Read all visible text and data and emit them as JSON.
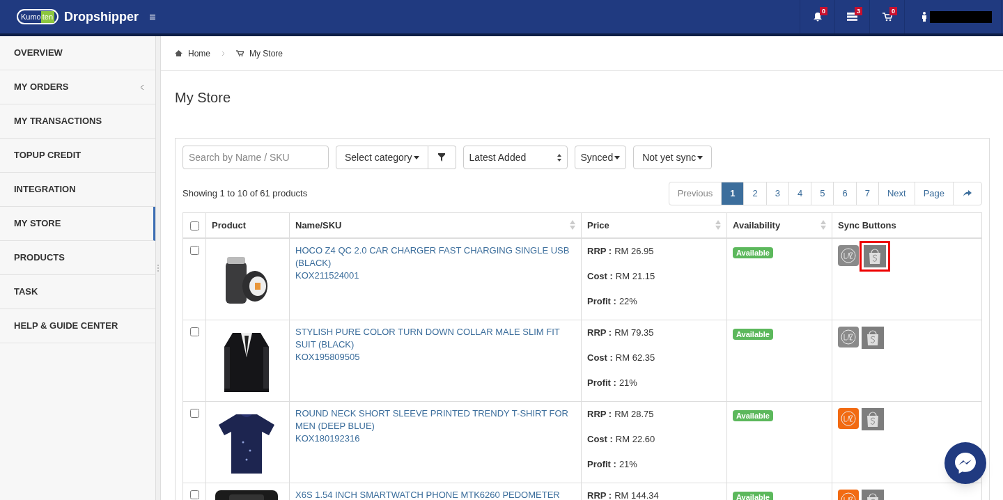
{
  "header": {
    "logo": {
      "word_a": "Kumo",
      "word_b": "ten"
    },
    "title": "Dropshipper",
    "badges": [
      {
        "kind": "bell",
        "count": "0"
      },
      {
        "kind": "messages",
        "count": "3"
      },
      {
        "kind": "cart",
        "count": "0"
      }
    ]
  },
  "sidebar": {
    "items": [
      {
        "label": "OVERVIEW",
        "selected": false,
        "expandable": false
      },
      {
        "label": "MY ORDERS",
        "selected": false,
        "expandable": true
      },
      {
        "label": "MY TRANSACTIONS",
        "selected": false,
        "expandable": false
      },
      {
        "label": "TOPUP CREDIT",
        "selected": false,
        "expandable": false
      },
      {
        "label": "INTEGRATION",
        "selected": false,
        "expandable": false
      },
      {
        "label": "MY STORE",
        "selected": true,
        "expandable": false
      },
      {
        "label": "PRODUCTS",
        "selected": false,
        "expandable": false
      },
      {
        "label": "TASK",
        "selected": false,
        "expandable": false
      },
      {
        "label": "HELP & GUIDE CENTER",
        "selected": false,
        "expandable": false
      }
    ]
  },
  "breadcrumb": [
    {
      "kind": "home",
      "label": "Home"
    },
    {
      "kind": "cart",
      "label": "My Store"
    }
  ],
  "page_title": "My Store",
  "filters": {
    "search": {
      "placeholder": "Search by Name / SKU"
    },
    "category": "Select category",
    "sort": "Latest Added",
    "synced": "Synced",
    "not_synced": "Not yet sync"
  },
  "summary": "Showing 1 to 10 of 61 products",
  "pagination": [
    {
      "label": "Previous",
      "selected": false,
      "disabled": true
    },
    {
      "label": "1",
      "selected": true,
      "disabled": false
    },
    {
      "label": "2",
      "selected": false,
      "disabled": false
    },
    {
      "label": "3",
      "selected": false,
      "disabled": false
    },
    {
      "label": "4",
      "selected": false,
      "disabled": false
    },
    {
      "label": "5",
      "selected": false,
      "disabled": false
    },
    {
      "label": "6",
      "selected": false,
      "disabled": false
    },
    {
      "label": "7",
      "selected": false,
      "disabled": false
    },
    {
      "label": "Next",
      "selected": false,
      "disabled": false
    },
    {
      "label": "Page",
      "selected": false,
      "disabled": false
    }
  ],
  "table": {
    "select_all_checked": false,
    "columns": [
      {
        "label": "Product",
        "sortable": false
      },
      {
        "label": "Name/SKU",
        "sortable": true
      },
      {
        "label": "Price",
        "sortable": true
      },
      {
        "label": "Availability",
        "sortable": true
      },
      {
        "label": "Sync Buttons",
        "sortable": false
      }
    ],
    "rows": [
      {
        "checked": false,
        "name": "HOCO Z4 QC 2.0 CAR CHARGER FAST CHARGING SINGLE USB (BLACK)",
        "sku": "KOX211524001",
        "prices": [
          {
            "label": "RRP :",
            "value": "RM 26.95"
          },
          {
            "label": "Cost :",
            "value": "RM 21.15"
          },
          {
            "label": "Profit :",
            "value": "22%"
          }
        ],
        "availability": "Available",
        "lazada_synced": false,
        "shopee_synced": false,
        "shopee_highlighted": true
      },
      {
        "checked": false,
        "name": "STYLISH PURE COLOR TURN DOWN COLLAR MALE SLIM FIT SUIT (BLACK)",
        "sku": "KOX195809505",
        "prices": [
          {
            "label": "RRP :",
            "value": "RM 79.35"
          },
          {
            "label": "Cost :",
            "value": "RM 62.35"
          },
          {
            "label": "Profit :",
            "value": "21%"
          }
        ],
        "availability": "Available",
        "lazada_synced": false,
        "shopee_synced": false,
        "shopee_highlighted": false
      },
      {
        "checked": false,
        "name": "ROUND NECK SHORT SLEEVE PRINTED TRENDY T-SHIRT FOR MEN (DEEP BLUE)",
        "sku": "KOX180192316",
        "prices": [
          {
            "label": "RRP :",
            "value": "RM 28.75"
          },
          {
            "label": "Cost :",
            "value": "RM 22.60"
          },
          {
            "label": "Profit :",
            "value": "21%"
          }
        ],
        "availability": "Available",
        "lazada_synced": true,
        "shopee_synced": false,
        "shopee_highlighted": false
      },
      {
        "checked": false,
        "name": "X6S 1.54 INCH SMARTWATCH PHONE MTK6260 PEDOMETER",
        "prices": [
          {
            "label": "RRP :",
            "value": "RM 144.34"
          }
        ],
        "availability": "Available",
        "lazada_synced": true,
        "shopee_synced": false,
        "shopee_highlighted": false
      }
    ]
  }
}
